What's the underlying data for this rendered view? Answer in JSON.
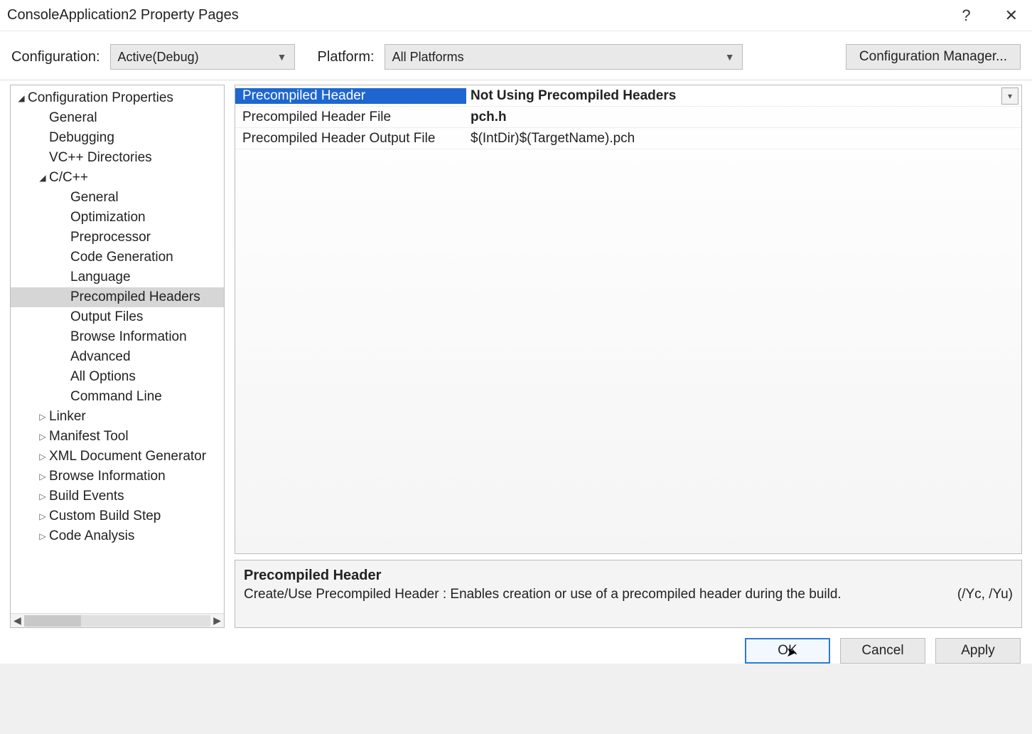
{
  "window_title": "ConsoleApplication2 Property Pages",
  "toolbar": {
    "configuration_label": "Configuration:",
    "configuration_value": "Active(Debug)",
    "platform_label": "Platform:",
    "platform_value": "All Platforms",
    "config_manager_label": "Configuration Manager..."
  },
  "tree": {
    "root": "Configuration Properties",
    "items_top": [
      "General",
      "Debugging",
      "VC++ Directories"
    ],
    "cpp": {
      "label": "C/C++",
      "children": [
        "General",
        "Optimization",
        "Preprocessor",
        "Code Generation",
        "Language",
        "Precompiled Headers",
        "Output Files",
        "Browse Information",
        "Advanced",
        "All Options",
        "Command Line"
      ],
      "selected": "Precompiled Headers"
    },
    "items_bottom": [
      "Linker",
      "Manifest Tool",
      "XML Document Generator",
      "Browse Information",
      "Build Events",
      "Custom Build Step",
      "Code Analysis"
    ]
  },
  "grid": [
    {
      "name": "Precompiled Header",
      "value": "Not Using Precompiled Headers",
      "selected": true,
      "bold": true,
      "dropdown": true
    },
    {
      "name": "Precompiled Header File",
      "value": "pch.h",
      "bold": true
    },
    {
      "name": "Precompiled Header Output File",
      "value": "$(IntDir)$(TargetName).pch"
    }
  ],
  "description": {
    "title": "Precompiled Header",
    "body": "Create/Use Precompiled Header : Enables creation or use of a precompiled header during the build.",
    "flags": "(/Yc, /Yu)"
  },
  "footer": {
    "ok": "OK",
    "cancel": "Cancel",
    "apply": "Apply"
  }
}
